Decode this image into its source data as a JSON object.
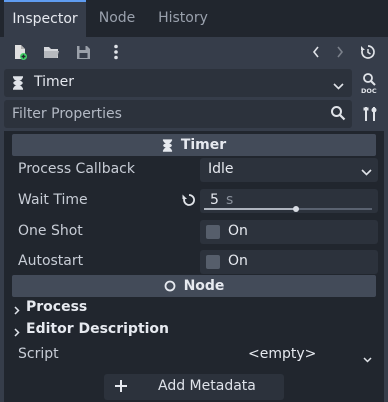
{
  "tabs": [
    {
      "label": "Inspector",
      "active": true
    },
    {
      "label": "Node",
      "active": false
    },
    {
      "label": "History",
      "active": false
    }
  ],
  "toolbar": {
    "icons": [
      "new-resource-icon",
      "open-folder-icon",
      "save-icon",
      "more-vert-icon",
      "back-icon",
      "forward-icon",
      "history-icon"
    ]
  },
  "node_selector": {
    "label": "Timer",
    "icon": "hourglass-icon"
  },
  "filter": {
    "placeholder": "Filter Properties"
  },
  "sections": {
    "timer_header": "Timer",
    "node_header": "Node"
  },
  "properties": {
    "process_callback": {
      "name": "Process Callback",
      "value": "Idle"
    },
    "wait_time": {
      "name": "Wait Time",
      "value": "5",
      "unit": "s",
      "slider_fraction": 0.55
    },
    "one_shot": {
      "name": "One Shot",
      "value": "On",
      "checked": false
    },
    "autostart": {
      "name": "Autostart",
      "value": "On",
      "checked": false
    }
  },
  "groups": {
    "process": "Process",
    "editor_description": "Editor Description"
  },
  "script": {
    "name": "Script",
    "value": "<empty>"
  },
  "add_metadata": "Add Metadata",
  "colors": {
    "accent": "#5f9cf0",
    "panel": "#21262e",
    "background": "#363d4a"
  }
}
